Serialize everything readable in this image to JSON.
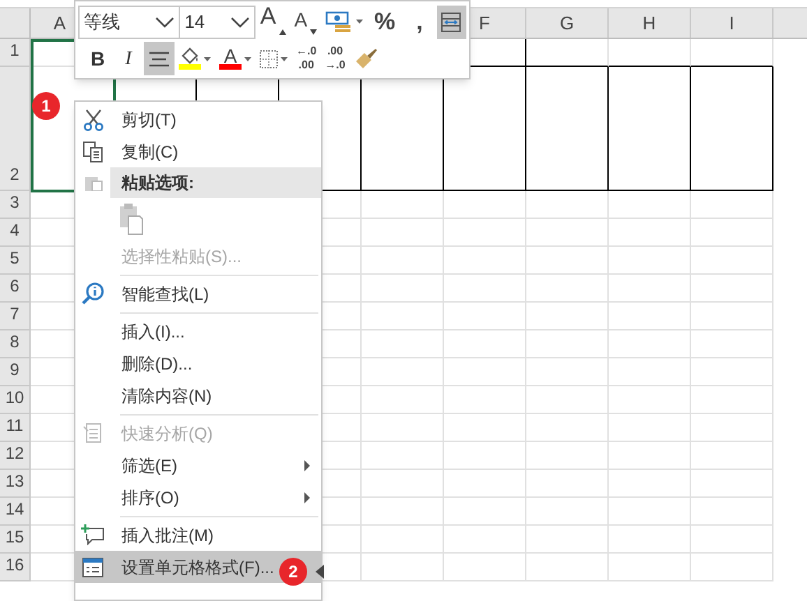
{
  "columns": [
    "A",
    "F",
    "G",
    "H",
    "I"
  ],
  "rows": [
    "1",
    "2",
    "3",
    "4",
    "5",
    "6",
    "7",
    "8",
    "9",
    "10",
    "11",
    "12",
    "13",
    "14",
    "15",
    "16"
  ],
  "mini_toolbar": {
    "font_name": "等线",
    "font_size": "14",
    "row_1": [
      {
        "kind": "grow",
        "label": "A",
        "selected": false
      },
      {
        "kind": "shrink",
        "label": "A",
        "selected": false
      },
      {
        "kind": "accounting",
        "selected": false
      },
      {
        "kind": "text",
        "label": "%",
        "selected": false
      },
      {
        "kind": "text",
        "label": ",",
        "selected": false
      },
      {
        "kind": "wrap",
        "selected": true
      }
    ],
    "row_2": [
      {
        "kind": "bold",
        "label": "B",
        "selected": false
      },
      {
        "kind": "italic",
        "label": "I",
        "selected": false
      },
      {
        "kind": "align",
        "selected": true
      },
      {
        "kind": "fill",
        "color": "#ffff00",
        "selected": false
      },
      {
        "kind": "fontcolor",
        "label": "A",
        "color": "#ff0000",
        "selected": false
      },
      {
        "kind": "border",
        "selected": false
      },
      {
        "kind": "decimal_more",
        "label": "←.0",
        "label_2": ".00",
        "selected": false
      },
      {
        "kind": "decimal_less",
        "label": ".00",
        "label_2": "→.0",
        "selected": false
      },
      {
        "kind": "painter",
        "selected": false
      }
    ]
  },
  "context_menu": [
    {
      "kind": "item",
      "label": "剪切(T)",
      "disabled": false,
      "selected": false,
      "submenu": false
    },
    {
      "kind": "item",
      "label": "复制(C)",
      "disabled": false,
      "selected": false,
      "submenu": false
    },
    {
      "kind": "header",
      "label": "粘贴选项:"
    },
    {
      "kind": "paste"
    },
    {
      "kind": "item",
      "label": "选择性粘贴(S)...",
      "disabled": true,
      "selected": false,
      "submenu": false
    },
    {
      "kind": "separator"
    },
    {
      "kind": "item",
      "label": "智能查找(L)",
      "disabled": false,
      "selected": false,
      "submenu": false
    },
    {
      "kind": "separator"
    },
    {
      "kind": "item",
      "label": "插入(I)...",
      "disabled": false,
      "selected": false,
      "submenu": false
    },
    {
      "kind": "item",
      "label": "删除(D)...",
      "disabled": false,
      "selected": false,
      "submenu": false
    },
    {
      "kind": "item",
      "label": "清除内容(N)",
      "disabled": false,
      "selected": false,
      "submenu": false
    },
    {
      "kind": "separator"
    },
    {
      "kind": "item",
      "label": "快速分析(Q)",
      "disabled": true,
      "selected": false,
      "submenu": false
    },
    {
      "kind": "item",
      "label": "筛选(E)",
      "disabled": false,
      "selected": false,
      "submenu": true
    },
    {
      "kind": "item",
      "label": "排序(O)",
      "disabled": false,
      "selected": false,
      "submenu": true
    },
    {
      "kind": "separator"
    },
    {
      "kind": "item",
      "label": "插入批注(M)",
      "disabled": false,
      "selected": false,
      "submenu": false
    },
    {
      "kind": "item",
      "label": "设置单元格格式(F)...",
      "disabled": false,
      "selected": true,
      "submenu": false
    }
  ],
  "badges": [
    "1",
    "2"
  ]
}
